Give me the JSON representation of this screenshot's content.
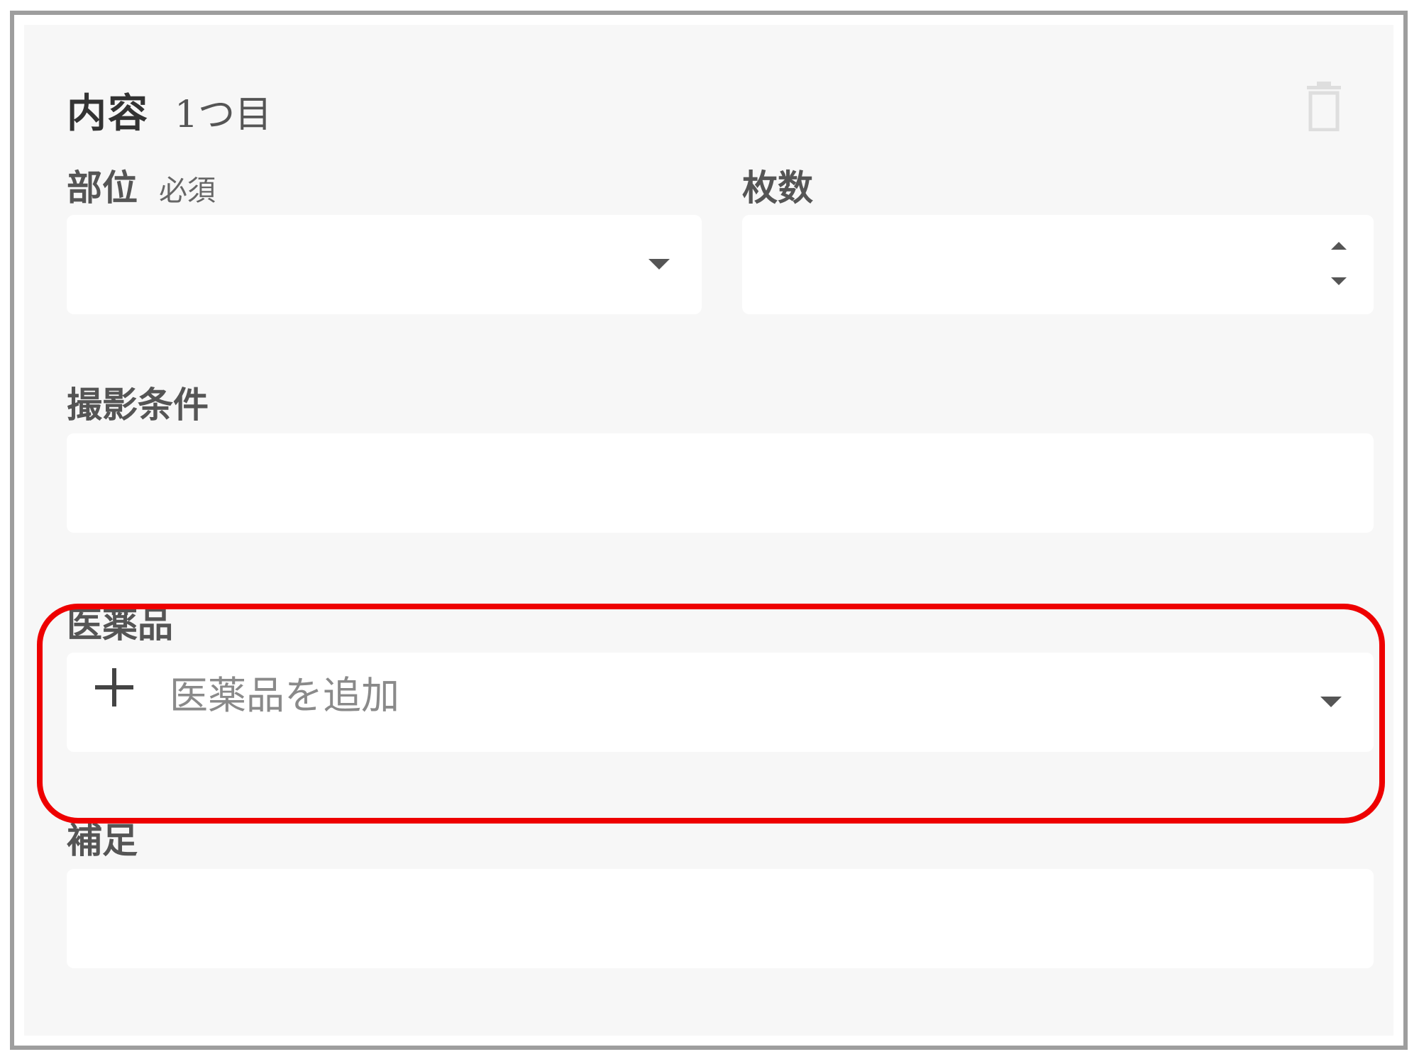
{
  "card": {
    "title": "内容",
    "subtitle": "1つ目",
    "delete_icon": "trash-icon"
  },
  "fields": {
    "site": {
      "label": "部位",
      "required_label": "必須",
      "value": "",
      "icon": "chevron-down-icon"
    },
    "count": {
      "label": "枚数",
      "value": "",
      "icon": "spinner-icon"
    },
    "conditions": {
      "label": "撮影条件",
      "value": ""
    },
    "medicine": {
      "label": "医薬品",
      "add_label": "医薬品を追加",
      "icon": "plus-icon"
    },
    "notes": {
      "label": "補足",
      "value": ""
    }
  },
  "colors": {
    "card_bg": "#f7f7f7",
    "input_bg": "#ffffff",
    "highlight": "#ee0000",
    "border": "#9e9e9e"
  }
}
